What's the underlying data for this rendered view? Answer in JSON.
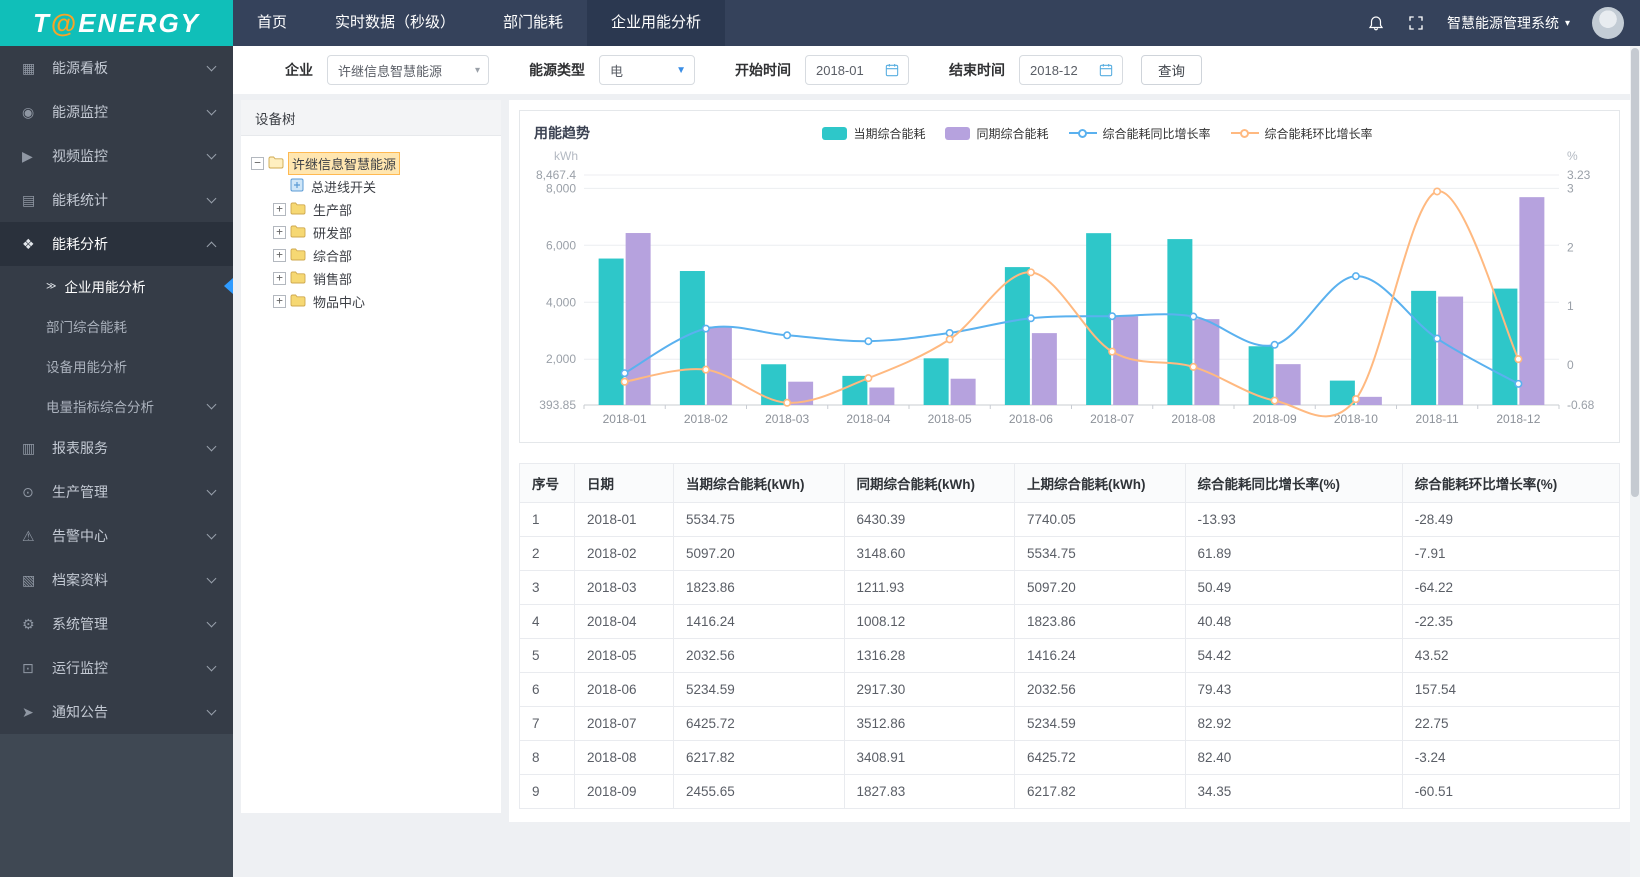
{
  "theme": {
    "c-topbar": "#35425b",
    "c-logo": "#10bfb9",
    "c-topnav-active": "#2b3850",
    "c-sidebar": "#3f4853",
    "c-sidebar-menu": "#353c47",
    "c-sidebar-active": "#2a313c",
    "c-sub-marker": "#2f9bff",
    "c-tree-sel": "#ffe6b0"
  },
  "topbar": {
    "logo": {
      "t": "T",
      "at": "@",
      "rest": "ENERGY"
    },
    "nav": [
      {
        "label": "首页",
        "active": false
      },
      {
        "label": "实时数据（秒级）",
        "active": false
      },
      {
        "label": "部门能耗",
        "active": false
      },
      {
        "label": "企业用能分析",
        "active": true
      }
    ],
    "system_name": "智慧能源管理系统",
    "icons": [
      "bell-icon",
      "fullscreen-icon",
      "chevron-down-icon",
      "avatar"
    ]
  },
  "sidebar": {
    "items": [
      {
        "label": "能源看板",
        "icon": "dashboard-icon",
        "glyph": "▦"
      },
      {
        "label": "能源监控",
        "icon": "energy-monitor-icon",
        "glyph": "◉"
      },
      {
        "label": "视频监控",
        "icon": "video-monitor-icon",
        "glyph": "▶"
      },
      {
        "label": "能耗统计",
        "icon": "energy-stats-icon",
        "glyph": "▤"
      },
      {
        "label": "能耗分析",
        "icon": "energy-analysis-icon",
        "glyph": "❖",
        "active": true,
        "expanded": true,
        "children": [
          {
            "label": "企业用能分析",
            "active": true
          },
          {
            "label": "部门综合能耗",
            "active": false
          },
          {
            "label": "设备用能分析",
            "active": false
          },
          {
            "label": "电量指标综合分析",
            "active": false,
            "expandable": true
          }
        ]
      },
      {
        "label": "报表服务",
        "icon": "report-service-icon",
        "glyph": "▥"
      },
      {
        "label": "生产管理",
        "icon": "production-icon",
        "glyph": "⊙"
      },
      {
        "label": "告警中心",
        "icon": "alarm-center-icon",
        "glyph": "⚠"
      },
      {
        "label": "档案资料",
        "icon": "archive-icon",
        "glyph": "▧"
      },
      {
        "label": "系统管理",
        "icon": "system-manage-icon",
        "glyph": "⚙"
      },
      {
        "label": "运行监控",
        "icon": "operation-monitor-icon",
        "glyph": "⊡"
      },
      {
        "label": "通知公告",
        "icon": "notice-icon",
        "glyph": "➤"
      }
    ]
  },
  "filters": {
    "company_label": "企业",
    "company_value": "许继信息智慧能源",
    "energy_label": "能源类型",
    "energy_value": "电",
    "start_label": "开始时间",
    "start_value": "2018-01",
    "end_label": "结束时间",
    "end_value": "2018-12",
    "query_button": "查询"
  },
  "tree": {
    "title": "设备树",
    "root": {
      "label": "许继信息智慧能源",
      "selected": true,
      "expanded": true
    },
    "children": [
      {
        "label": "总进线开关",
        "leaf": true,
        "icon": "device-icon"
      },
      {
        "label": "生产部",
        "leaf": false,
        "icon": "folder-icon"
      },
      {
        "label": "研发部",
        "leaf": false,
        "icon": "folder-icon"
      },
      {
        "label": "综合部",
        "leaf": false,
        "icon": "folder-icon"
      },
      {
        "label": "销售部",
        "leaf": false,
        "icon": "folder-icon"
      },
      {
        "label": "物品中心",
        "leaf": false,
        "icon": "folder-icon"
      }
    ]
  },
  "chart_data": {
    "type": "bar",
    "title": "用能趋势",
    "categories": [
      "2018-01",
      "2018-02",
      "2018-03",
      "2018-04",
      "2018-05",
      "2018-06",
      "2018-07",
      "2018-08",
      "2018-09",
      "2018-10",
      "2018-11",
      "2018-12"
    ],
    "series": [
      {
        "name": "当期综合能耗",
        "type": "bar",
        "axis": "left",
        "color": "#2ec7c9",
        "values": [
          5534.75,
          5097.2,
          1823.86,
          1416.24,
          2032.56,
          5234.59,
          6425.72,
          6217.82,
          2455.65,
          1250,
          4400,
          4480
        ]
      },
      {
        "name": "同期综合能耗",
        "type": "bar",
        "axis": "left",
        "color": "#b6a2de",
        "values": [
          6430.39,
          3148.6,
          1211.93,
          1008.12,
          1316.28,
          2917.3,
          3512.86,
          3408.91,
          1827.83,
          680,
          4200,
          7690
        ]
      },
      {
        "name": "综合能耗同比增长率",
        "type": "line",
        "axis": "right",
        "color": "#5ab1ef",
        "values": [
          -0.1393,
          0.6189,
          0.5049,
          0.4048,
          0.5442,
          0.7943,
          0.8292,
          0.824,
          0.3435,
          1.51,
          0.45,
          -0.32
        ]
      },
      {
        "name": "综合能耗环比增长率",
        "type": "line",
        "axis": "right",
        "color": "#ffb980",
        "values": [
          -0.2849,
          -0.0791,
          -0.6422,
          -0.2235,
          0.4352,
          1.5754,
          0.2275,
          -0.0324,
          -0.6051,
          -0.58,
          2.95,
          0.1
        ]
      }
    ],
    "left_axis": {
      "name": "kWh",
      "min": 393.85,
      "max": 8467.4,
      "ticks": [
        {
          "v": 393.85,
          "label": "393.85"
        },
        {
          "v": 2000,
          "label": "2,000"
        },
        {
          "v": 4000,
          "label": "4,000"
        },
        {
          "v": 6000,
          "label": "6,000"
        },
        {
          "v": 8000,
          "label": "8,000"
        },
        {
          "v": 8467.4,
          "label": "8,467.4"
        }
      ]
    },
    "right_axis": {
      "name": "%",
      "min": -0.68,
      "max": 3.23,
      "ticks": [
        {
          "v": -0.68,
          "label": "-0.68"
        },
        {
          "v": 0,
          "label": "0"
        },
        {
          "v": 1,
          "label": "1"
        },
        {
          "v": 2,
          "label": "2"
        },
        {
          "v": 3,
          "label": "3"
        },
        {
          "v": 3.23,
          "label": "3.23"
        }
      ]
    },
    "grid": true,
    "legend_position": "top-center"
  },
  "table": {
    "headers": [
      "序号",
      "日期",
      "当期综合能耗(kWh)",
      "同期综合能耗(kWh)",
      "上期综合能耗(kWh)",
      "综合能耗同比增长率(%)",
      "综合能耗环比增长率(%)"
    ],
    "rows": [
      [
        "1",
        "2018-01",
        "5534.75",
        "6430.39",
        "7740.05",
        "-13.93",
        "-28.49"
      ],
      [
        "2",
        "2018-02",
        "5097.20",
        "3148.60",
        "5534.75",
        "61.89",
        "-7.91"
      ],
      [
        "3",
        "2018-03",
        "1823.86",
        "1211.93",
        "5097.20",
        "50.49",
        "-64.22"
      ],
      [
        "4",
        "2018-04",
        "1416.24",
        "1008.12",
        "1823.86",
        "40.48",
        "-22.35"
      ],
      [
        "5",
        "2018-05",
        "2032.56",
        "1316.28",
        "1416.24",
        "54.42",
        "43.52"
      ],
      [
        "6",
        "2018-06",
        "5234.59",
        "2917.30",
        "2032.56",
        "79.43",
        "157.54"
      ],
      [
        "7",
        "2018-07",
        "6425.72",
        "3512.86",
        "5234.59",
        "82.92",
        "22.75"
      ],
      [
        "8",
        "2018-08",
        "6217.82",
        "3408.91",
        "6425.72",
        "82.40",
        "-3.24"
      ],
      [
        "9",
        "2018-09",
        "2455.65",
        "1827.83",
        "6217.82",
        "34.35",
        "-60.51"
      ]
    ]
  }
}
